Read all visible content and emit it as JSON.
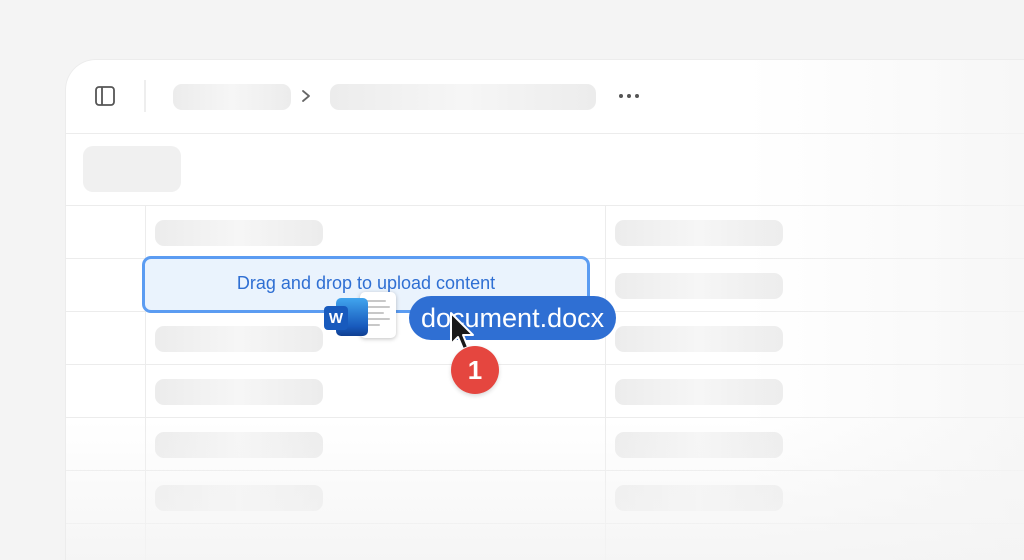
{
  "toolbar": {
    "sidebar_toggle_icon": "sidebar-toggle-icon",
    "separator_icon": "chevron-right-icon",
    "more_icon": "more-horizontal-icon"
  },
  "drop_zone": {
    "label": "Drag and drop to upload content"
  },
  "dragged_file": {
    "name": "document.docx",
    "icon": "word-document-icon"
  },
  "step": {
    "number": "1"
  },
  "colors": {
    "accent": "#2f6fd3",
    "drop_border": "#5b9cf2",
    "drop_fill": "#eaf3fd",
    "badge": "#e5463f"
  }
}
